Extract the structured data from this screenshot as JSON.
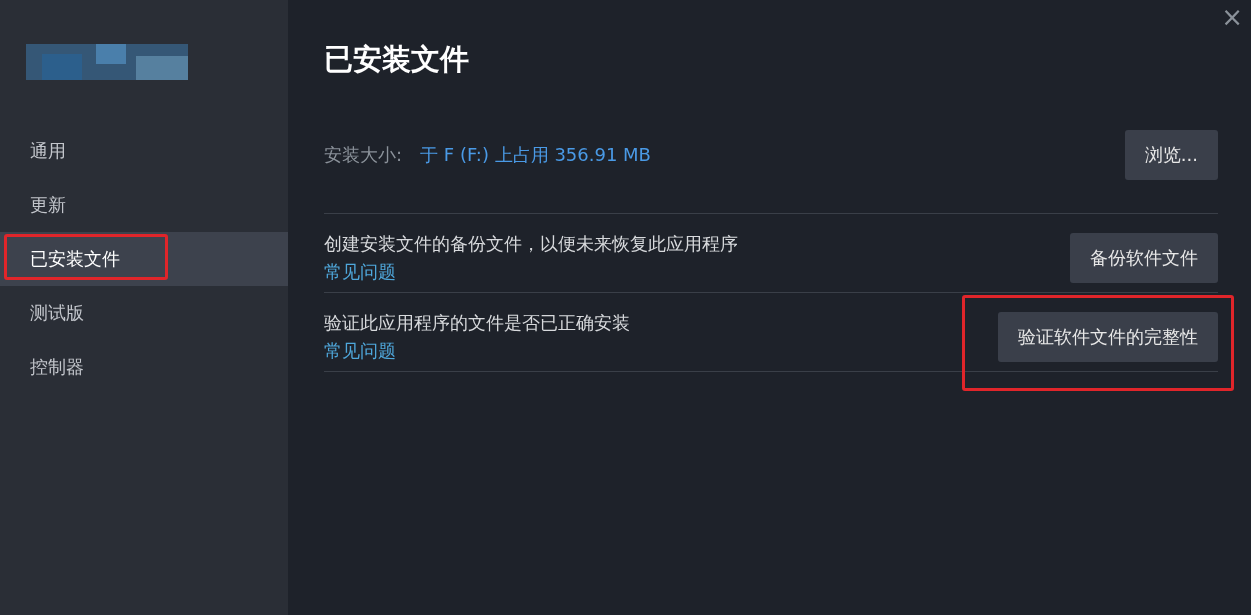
{
  "sidebar": {
    "items": [
      {
        "label": "通用",
        "selected": false,
        "highlighted": false
      },
      {
        "label": "更新",
        "selected": false,
        "highlighted": false
      },
      {
        "label": "已安装文件",
        "selected": true,
        "highlighted": true
      },
      {
        "label": "测试版",
        "selected": false,
        "highlighted": false
      },
      {
        "label": "控制器",
        "selected": false,
        "highlighted": false
      }
    ]
  },
  "close": "×",
  "title": "已安装文件",
  "install_size": {
    "label": "安装大小:",
    "value": "于 F (F:) 上占用 356.91 MB",
    "button": "浏览..."
  },
  "actions": [
    {
      "text": "创建安装文件的备份文件，以便未来恢复此应用程序",
      "link": "常见问题",
      "button": "备份软件文件",
      "highlighted": false
    },
    {
      "text": "验证此应用程序的文件是否已正确安装",
      "link": "常见问题",
      "button": "验证软件文件的完整性",
      "highlighted": true
    }
  ]
}
